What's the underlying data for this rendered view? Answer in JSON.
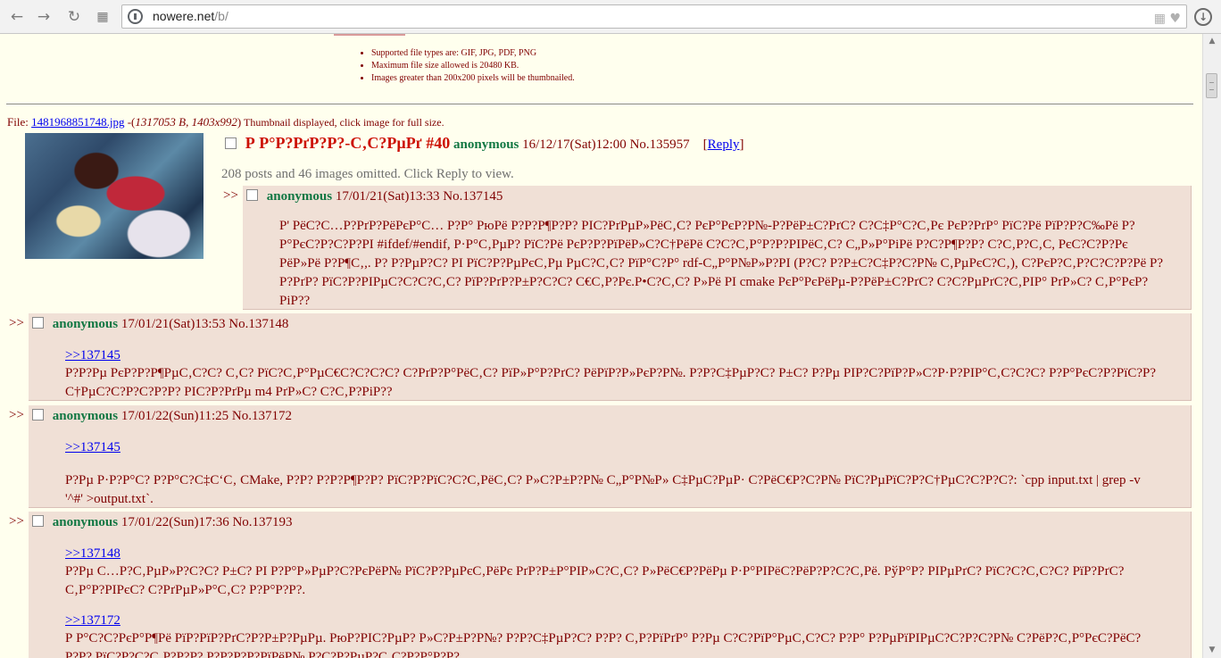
{
  "browser": {
    "url_host": "nowere.net",
    "url_path": "/b/"
  },
  "rules": [
    "Supported file types are: GIF, JPG, PDF, PNG",
    "Maximum file size allowed is 20480 KB.",
    "Images greater than 200x200 pixels will be thumbnailed."
  ],
  "op": {
    "file_label": "File: ",
    "file_name": "1481968851748.jpg",
    "file_meta_open": " -(",
    "file_meta": "1317053 B, 1403x992",
    "file_meta_close": ")",
    "file_note": " Thumbnail displayed, click image for full size.",
    "subject": "Р Р°Р?РґР?Р?-С‚С?РµРґ #40",
    "name": "anonymous",
    "date": "16/12/17(Sat)12:00",
    "number": "No.135957",
    "reply_label": "Reply",
    "omitted": "208 posts and 46 images omitted. Click Reply to view."
  },
  "replies": [
    {
      "prefix": ">>",
      "name": "anonymous",
      "date": "17/01/21(Sat)13:33",
      "number": "No.137145",
      "quote": "",
      "message": "Р' РёС?С…Р?РґР?РёРєР°С… Р?Р° РюРё Р?Р?Р¶Р?Р? РІС?РґРµР»РёС‚С? РєР°РєР?Р№-Р?РёР±С?РґС? С?С‡Р°С?С‚Рє РєР?РґР° РїС?Рё РїР?Р?С‰Рё Р?Р°РєС?Р?С?Р?РІ #ifdef/#endif, Р·Р°С‚РµР? РїС?Рё РєР?Р?РїРёР»С?С†РёРё С?С?С‚Р°Р?Р?РІРёС‚С? С„Р»Р°РіРё Р?С?Р¶Р?Р? С?С‚Р?С‚С, РєС?С?Р?Рє РёР»Рё Р?Р¶С‚,. Р? Р?РµР?С? РІ РїС?Р?РµРєС‚Рµ РµС?С‚С? РїР°С?Р° rdf-С„Р°Р№Р»Р?РІ (Р?С? Р?Р±С?С‡Р?С?Р№ С‚РµРєС?С‚), С?РєР?С‚Р?С?С?Р?Рё Р?Р?РґР? РїС?Р?РІРµС?С?С?С‚С? РїР?РґР?Р±Р?С?С? С€С‚Р?Рє.Р•С?С‚С? Р»Рё РІ cmake РєР°РєРёРµ-Р?РёР±С?РґС? С?С?РµРґС?С‚РІР° РґР»С? С‚Р°РєР?РіР??"
    },
    {
      "prefix": ">>",
      "name": "anonymous",
      "date": "17/01/21(Sat)13:53",
      "number": "No.137148",
      "quote": ">>137145",
      "message": "Р?Р?Рµ РєР?Р?Р¶РµС‚С?С? С‚С? РїС?С‚Р°РµС€С?С?С?С? С?РґР?Р°РёС‚С? РїР»Р°Р?РґС? РёРїР?Р»РєР?Р№. Р?Р?С‡РµР?С? Р±С? Р?Рµ РІР?С?РїР?Р»С?Р·Р?РІР°С‚С?С?С? Р?Р°РєС?Р?РїС?Р?С†РµС?С?Р?С?Р?Р? РІС?Р?РґРµ m4 РґР»С? С?С‚Р?РіР??"
    },
    {
      "prefix": ">>",
      "name": "anonymous",
      "date": "17/01/22(Sun)11:25",
      "number": "No.137172",
      "quote": ">>137145",
      "message": "Р?Рµ Р·Р?Р°С? Р?Р°С?С‡С‘С‚ CMake, Р?Р? Р?Р?Р¶Р?Р? РїС?Р?РїС?С?С‚РёС‚С? Р»С?Р±Р?Р№ С„Р°Р№Р» С‡РµС?РµР· С?РёС€Р?С?Р№ РїС?РµРїС?Р?С†РµС?С?Р?С?: `cpp input.txt | grep -v '^#' >output.txt`."
    },
    {
      "prefix": ">>",
      "name": "anonymous",
      "date": "17/01/22(Sun)17:36",
      "number": "No.137193",
      "quote": ">>137148",
      "quote2": ">>137172",
      "message": "Р?Рµ С…Р?С‚РµР»Р?С?С? Р±С? РІ Р?Р°Р»РµР?С?РєРёР№ РїС?Р?РµРєС‚РёРє РґР?Р±Р°РІР»С?С‚С? Р»РёС€Р?РёРµ Р·Р°РІРёС?РёР?Р?С?С‚Рё. РўР°Р? РІРµРґС? РїС?С?С‚С?С? РїР?РґС?С‚Р°Р?РІРєС? С?РґРµР»Р°С‚С? Р?Р°Р?Р?.",
      "message2": "Р Р°С?С?РєР°Р¶Рё РїР?РїР?РґС?Р?Р±Р?РµРµ. РюР?РІС?РµР? Р»С?Р±Р?Р№? Р?Р?С‡РµР?С? Р?Р? С‚Р?РїРґР° Р?Рµ С?С?РїР°РµС‚С?С? Р?Р° Р?РµРїРІРµС?С?Р?С?Р№ С?РёР?С‚Р°РєС?РёС? Р?Р? РїС?Р?С?С‚Р?Р?Р? Р?Р?Р?Р?РїРёР№ Р?С?Р?РµР?С‚С?Р?Р°Р?Р?"
    }
  ]
}
